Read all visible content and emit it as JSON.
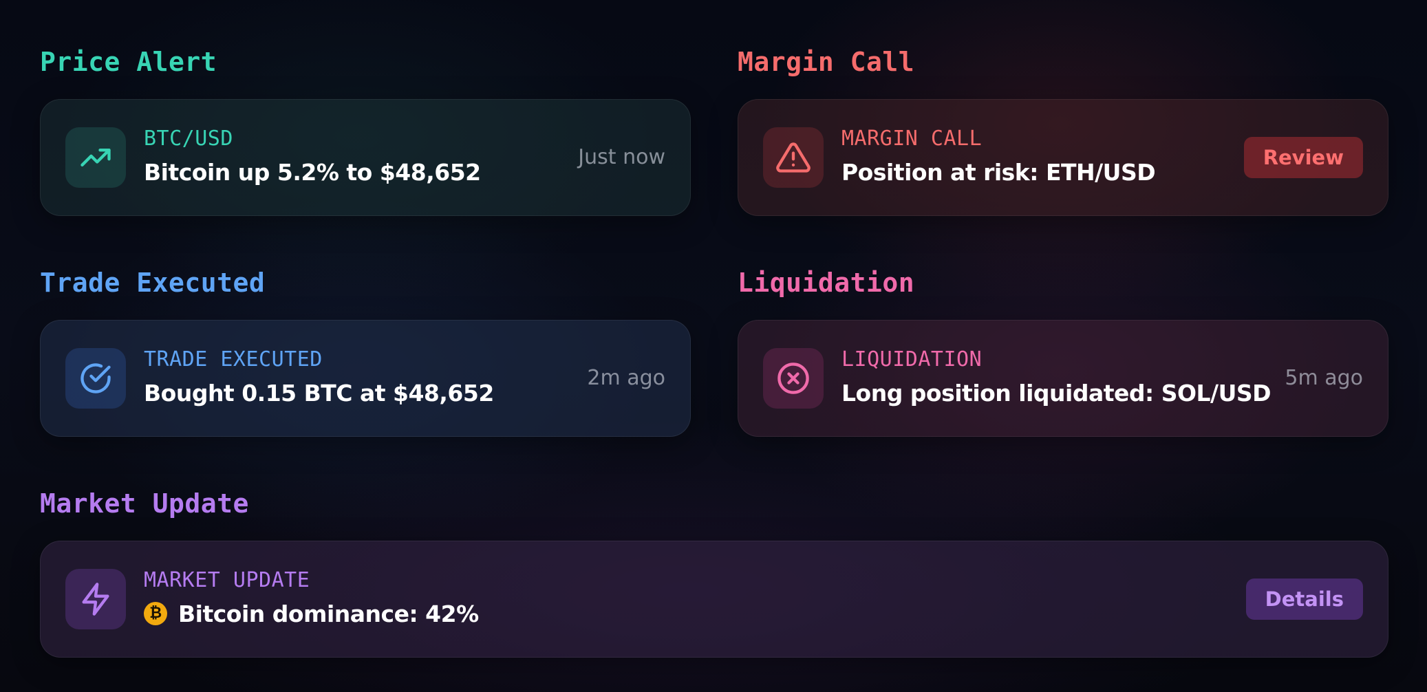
{
  "colors": {
    "price_alert": "#38d4b4",
    "margin_call": "#f56c6c",
    "trade_executed": "#5fa4f5",
    "liquidation": "#f06aaa",
    "market_update": "#b57cf0",
    "background": "#070a14"
  },
  "sections": {
    "price_alert": {
      "title": "Price Alert",
      "eyebrow": "BTC/USD",
      "message": "Bitcoin up 5.2% to $48,652",
      "time": "Just now",
      "icon": "trending-up-icon"
    },
    "margin_call": {
      "title": "Margin Call",
      "eyebrow": "MARGIN CALL",
      "message": "Position at risk: ETH/USD",
      "action_label": "Review",
      "icon": "warning-triangle-icon"
    },
    "trade_executed": {
      "title": "Trade Executed",
      "eyebrow": "TRADE EXECUTED",
      "message": "Bought 0.15 BTC at $48,652",
      "time": "2m ago",
      "icon": "check-circle-icon"
    },
    "liquidation": {
      "title": "Liquidation",
      "eyebrow": "LIQUIDATION",
      "message": "Long position liquidated: SOL/USD",
      "time": "5m ago",
      "icon": "x-circle-icon"
    },
    "market_update": {
      "title": "Market Update",
      "eyebrow": "MARKET UPDATE",
      "message": "Bitcoin dominance: 42%",
      "coin_symbol": "₿",
      "action_label": "Details",
      "icon": "lightning-icon"
    }
  }
}
